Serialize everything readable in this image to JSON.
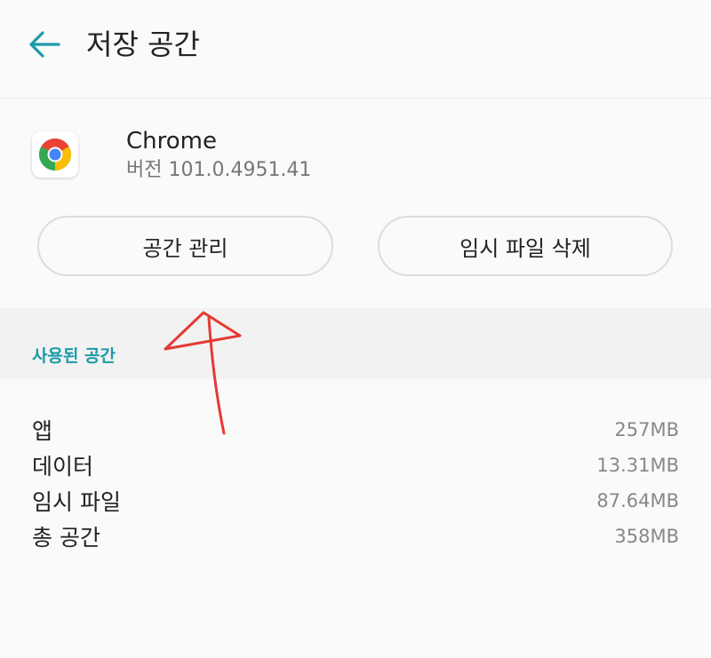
{
  "header": {
    "title": "저장 공간",
    "back_icon": "arrow-left-icon"
  },
  "app": {
    "name": "Chrome",
    "version": "버전 101.0.4951.41",
    "icon": "chrome-logo-icon"
  },
  "buttons": {
    "manage_space": "공간 관리",
    "clear_cache": "임시 파일 삭제"
  },
  "section": {
    "label": "사용된 공간"
  },
  "storage": {
    "rows": [
      {
        "label": "앱",
        "value": "257MB"
      },
      {
        "label": "데이터",
        "value": "13.31MB"
      },
      {
        "label": "임시 파일",
        "value": "87.64MB"
      },
      {
        "label": "총 공간",
        "value": "358MB"
      }
    ]
  },
  "colors": {
    "accent": "#1a9aa8",
    "annotation": "#e53935"
  }
}
